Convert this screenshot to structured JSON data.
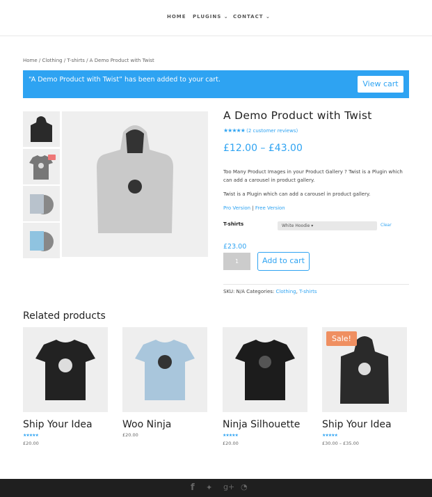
{
  "nav": {
    "items": [
      {
        "label": "HOME"
      },
      {
        "label": "PLUGINS ⌄"
      },
      {
        "label": "CONTACT ⌄"
      }
    ]
  },
  "breadcrumb": "Home / Clothing / T-shirts / A Demo Product with Twist",
  "notice": {
    "message": "“A Demo Product with Twist” has been added to your cart.",
    "button": "View cart",
    "color": "#2ea3f2"
  },
  "product": {
    "title": "A Demo Product with Twist",
    "rating": 4.5,
    "stars": "★★★★★",
    "reviews": "(2 customer reviews)",
    "price_range": "£12.00 – £43.00",
    "desc1": "Too Many Product Images in your Product Gallery ? Twist is a Plugin which can add a carousel in product gallery.",
    "desc2": "Twist is a Plugin which can add a carousel in product gallery.",
    "pro_link": "Pro Version",
    "sep": "|",
    "free_link": "Free Version",
    "variation_label": "T-shirts",
    "variation_value": "White Hoodie ▾",
    "clear": "Clear",
    "variation_price": "£23.00",
    "qty": "1",
    "add_to_cart": "Add to cart",
    "meta_prefix": "SKU: N/A Categories: ",
    "cat1": "Clothing",
    "cat_sep": ", ",
    "cat2": "T-shirts"
  },
  "related": {
    "heading": "Related products",
    "items": [
      {
        "name": "Ship Your Idea",
        "rating": 4.5,
        "stars": "★★★★★",
        "price": "£20.00"
      },
      {
        "name": "Woo Ninja",
        "price": "£20.00"
      },
      {
        "name": "Ninja Silhouette",
        "rating": 5,
        "stars": "★★★★★",
        "price": "£20.00"
      },
      {
        "name": "Ship Your Idea",
        "rating": 4,
        "stars": "★★★★★",
        "price": "£30.00 – £35.00",
        "badge": "Sale!"
      }
    ]
  },
  "footer": {
    "icons": [
      "facebook-icon",
      "twitter-icon",
      "google-plus-icon",
      "rss-icon"
    ],
    "glyphs": [
      "f",
      "g+"
    ]
  }
}
